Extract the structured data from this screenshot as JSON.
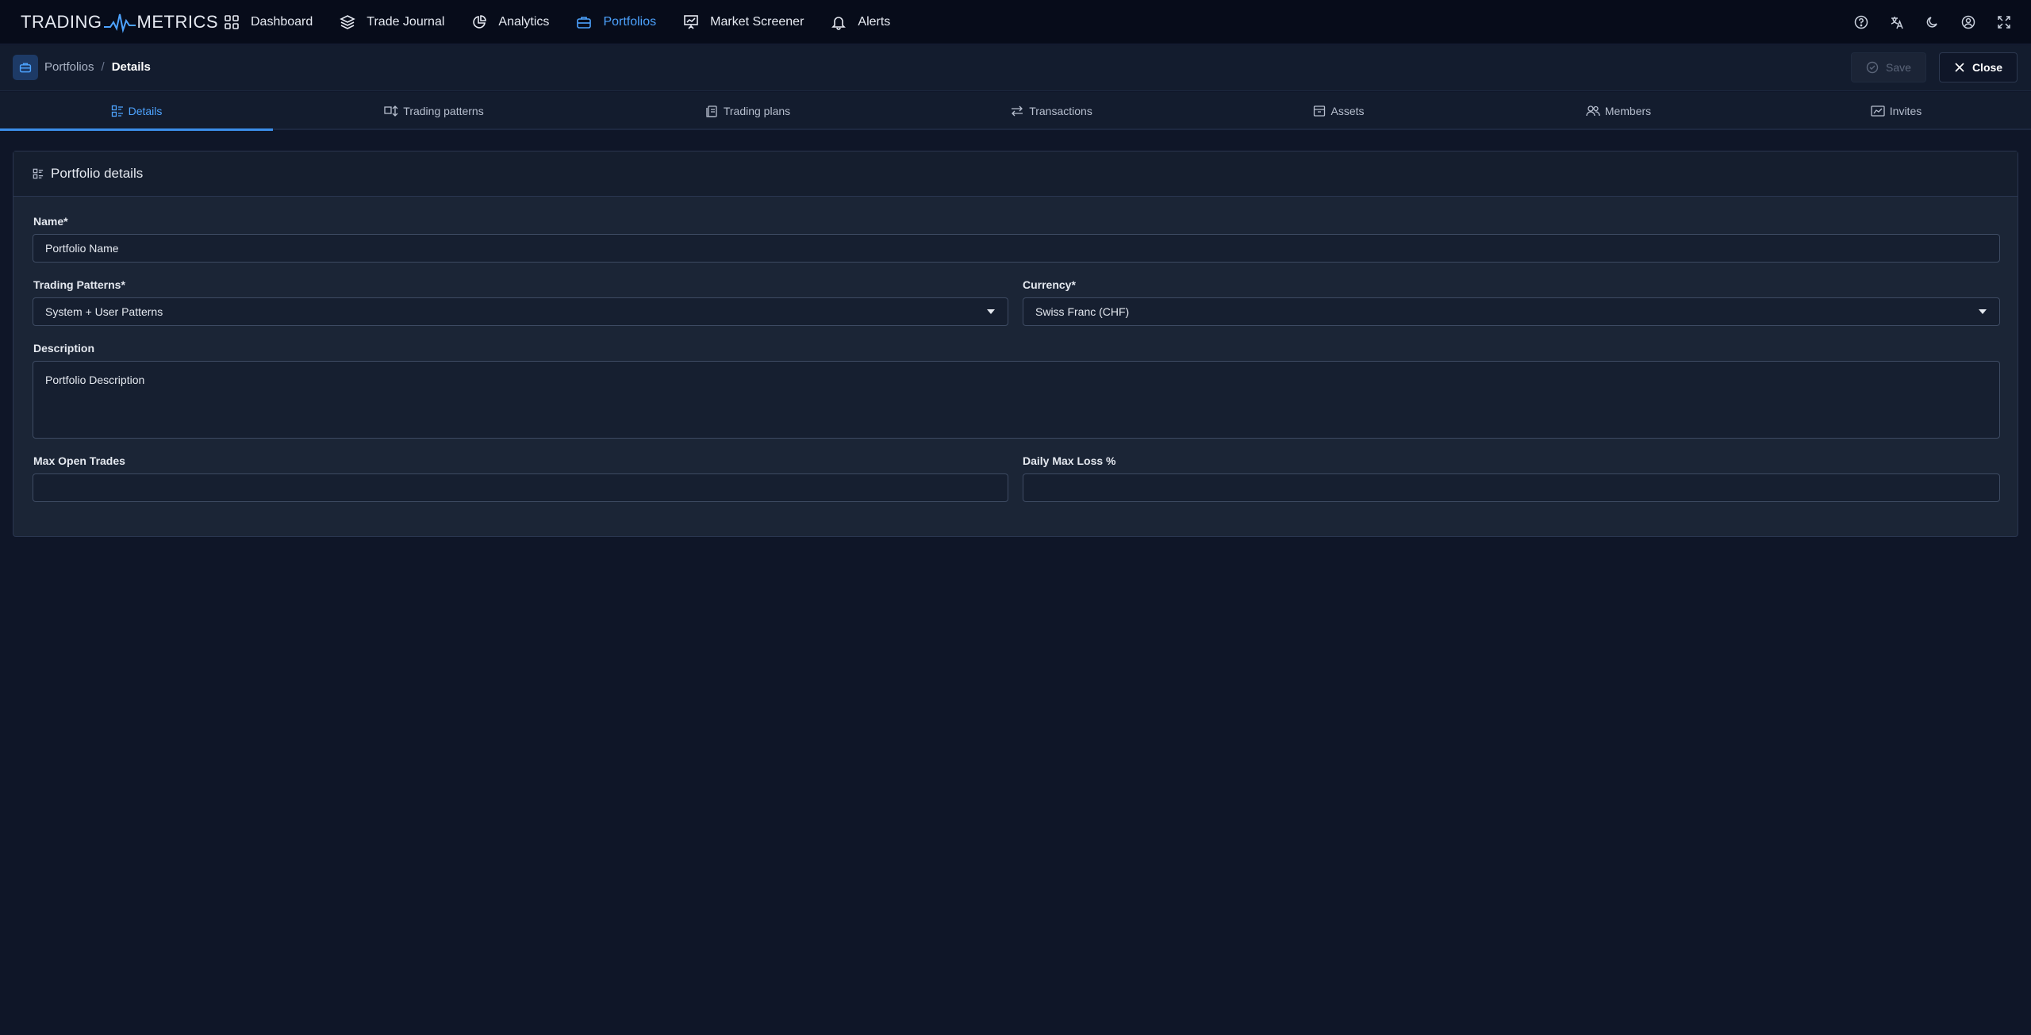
{
  "brand": {
    "left": "TRADING",
    "right": "METRICS",
    "accent": "#4da3ff"
  },
  "nav": {
    "items": [
      {
        "label": "Dashboard",
        "icon": "grid-icon",
        "active": false
      },
      {
        "label": "Trade Journal",
        "icon": "layers-icon",
        "active": false
      },
      {
        "label": "Analytics",
        "icon": "chart-pie-icon",
        "active": false
      },
      {
        "label": "Portfolios",
        "icon": "briefcase-icon",
        "active": true
      },
      {
        "label": "Market Screener",
        "icon": "presentation-chart-icon",
        "active": false
      },
      {
        "label": "Alerts",
        "icon": "bell-icon",
        "active": false
      }
    ],
    "right_icons": [
      "help-icon",
      "language-icon",
      "dark-mode-icon",
      "user-icon",
      "fullscreen-icon"
    ]
  },
  "breadcrumb": {
    "parent": "Portfolios",
    "separator": "/",
    "current": "Details"
  },
  "toolbar": {
    "save_label": "Save",
    "close_label": "Close"
  },
  "tabs": [
    {
      "label": "Details",
      "icon": "details-icon",
      "active": true
    },
    {
      "label": "Trading patterns",
      "icon": "patterns-icon",
      "active": false
    },
    {
      "label": "Trading plans",
      "icon": "plans-icon",
      "active": false
    },
    {
      "label": "Transactions",
      "icon": "transfer-icon",
      "active": false
    },
    {
      "label": "Assets",
      "icon": "box-icon",
      "active": false
    },
    {
      "label": "Members",
      "icon": "users-icon",
      "active": false
    },
    {
      "label": "Invites",
      "icon": "mail-icon",
      "active": false
    }
  ],
  "card": {
    "title": "Portfolio details",
    "fields": {
      "name": {
        "label": "Name*",
        "value": "Portfolio Name"
      },
      "trading_patterns": {
        "label": "Trading Patterns*",
        "value": "System + User Patterns"
      },
      "currency": {
        "label": "Currency*",
        "value": "Swiss Franc (CHF)"
      },
      "description": {
        "label": "Description",
        "value": "Portfolio Description"
      },
      "max_open_trades": {
        "label": "Max Open Trades",
        "value": ""
      },
      "daily_max_loss": {
        "label": "Daily Max Loss %",
        "value": ""
      }
    }
  }
}
